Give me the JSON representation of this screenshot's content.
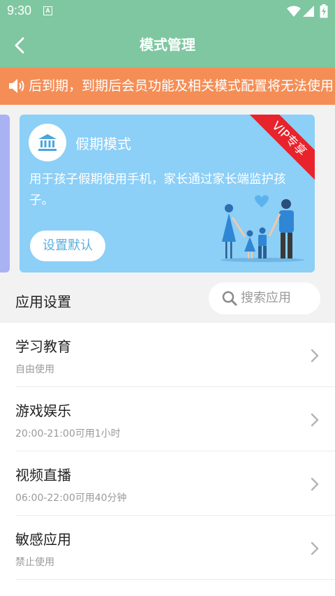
{
  "status_bar": {
    "time": "9:30",
    "notification_badge": "A"
  },
  "app_bar": {
    "title": "模式管理",
    "back_icon": "chevron-left-icon"
  },
  "notice": {
    "icon": "speaker-icon",
    "text": "后到期，到期后会员功能及相关模式配置将无法使用"
  },
  "mode_card": {
    "title": "假期模式",
    "description": "用于孩子假期使用手机，家长通过家长端监护孩子。",
    "default_button": "设置默认",
    "vip_ribbon": "VIP专享",
    "icon": "bank-icon",
    "card_color": "#8ccff7"
  },
  "app_settings": {
    "label": "应用设置",
    "search_placeholder": "搜索应用"
  },
  "categories": [
    {
      "name": "学习教育",
      "rule": "自由使用"
    },
    {
      "name": "游戏娱乐",
      "rule": "20:00-21:00可用1小时"
    },
    {
      "name": "视频直播",
      "rule": "06:00-22:00可用40分钟"
    },
    {
      "name": "敏感应用",
      "rule": "禁止使用"
    }
  ],
  "colors": {
    "primary": "#7ec7a0",
    "notice": "#f58e56",
    "vip": "#e8232c"
  }
}
